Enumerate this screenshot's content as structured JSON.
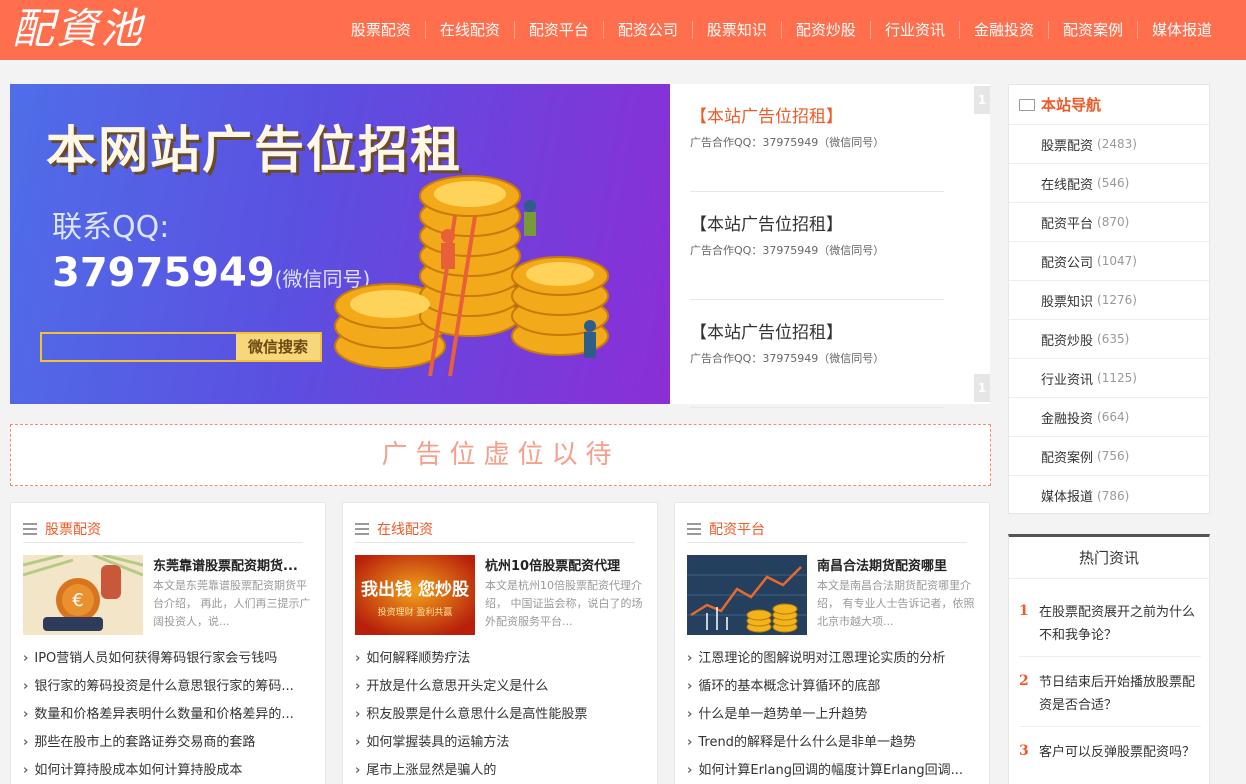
{
  "header": {
    "logo": "配資池",
    "nav": [
      "股票配资",
      "在线配资",
      "配资平台",
      "配资公司",
      "股票知识",
      "配资炒股",
      "行业资讯",
      "金融投资",
      "配资案例",
      "媒体报道"
    ]
  },
  "banner": {
    "title": "本网站广告位招租",
    "qq_label": "联系QQ:",
    "qq_number": "37975949",
    "qq_note": "(微信同号)",
    "search_button": "微信搜索"
  },
  "ads": [
    {
      "title": "【本站广告位招租】",
      "sub": "广告合作QQ：37975949（微信同号）"
    },
    {
      "title": "【本站广告位招租】",
      "sub": "广告合作QQ：37975949（微信同号）"
    },
    {
      "title": "【本站广告位招租】",
      "sub": "广告合作QQ：37975949（微信同号）"
    }
  ],
  "scroll_marks": [
    "1",
    "1"
  ],
  "placeholder": "广告位虚位以待",
  "cards": [
    {
      "title": "股票配资",
      "feature_title": "东莞靠谱股票配资期货...",
      "feature_desc": "本文是东莞靠谱股票配资期货平台介绍， 再此，人们再三提示广阔投资人，说...",
      "links": [
        "IPO营销人员如何获得筹码银行家会亏钱吗",
        "银行家的筹码投资是什么意思银行家的筹码...",
        "数量和价格差异表明什么数量和价格差异的...",
        "那些在股市上的套路证券交易商的套路",
        "如何计算持股成本如何计算持股成本"
      ]
    },
    {
      "title": "在线配资",
      "feature_title": "杭州10倍股票配资代理",
      "feature_desc": "本文是杭州10倍股票配资代理介绍， 中国证监会称，说白了的场外配资服务平台...",
      "thumb_text_1": "我出钱 您炒股",
      "thumb_text_2": "投资理财 盈利共赢",
      "links": [
        "如何解释顺势疗法",
        "开放是什么意思开头定义是什么",
        "积友股票是什么意思什么是高性能股票",
        "如何掌握装具的运输方法",
        "尾市上涨显然是骗人的"
      ]
    },
    {
      "title": "配资平台",
      "feature_title": "南昌合法期货配资哪里",
      "feature_desc": "本文是南昌合法期货配资哪里介绍， 有专业人士告诉记者，依照北京市越大项...",
      "links": [
        "江恩理论的图解说明对江恩理论实质的分析",
        "循环的基本概念计算循环的底部",
        "什么是单一趋势单一上升趋势",
        "Trend的解释是什么什么是非单一趋势",
        "如何计算Erlang回调的幅度计算Erlang回调..."
      ]
    }
  ],
  "sidenav": {
    "title": "本站导航",
    "items": [
      {
        "label": "股票配资",
        "count": "(2483)"
      },
      {
        "label": "在线配资",
        "count": "(546)"
      },
      {
        "label": "配资平台",
        "count": "(870)"
      },
      {
        "label": "配资公司",
        "count": "(1047)"
      },
      {
        "label": "股票知识",
        "count": "(1276)"
      },
      {
        "label": "配资炒股",
        "count": "(635)"
      },
      {
        "label": "行业资讯",
        "count": "(1125)"
      },
      {
        "label": "金融投资",
        "count": "(664)"
      },
      {
        "label": "配资案例",
        "count": "(756)"
      },
      {
        "label": "媒体报道",
        "count": "(786)"
      }
    ]
  },
  "hot": {
    "title": "热门资讯",
    "items": [
      {
        "num": "1",
        "text": "在股票配资展开之前为什么不和我争论？"
      },
      {
        "num": "2",
        "text": "节日结束后开始播放股票配资是否合适？"
      },
      {
        "num": "3",
        "text": "客户可以反弹股票配资吗？"
      }
    ]
  },
  "colors": {
    "brand": "#ff6f4d",
    "accent": "#f05a28"
  }
}
